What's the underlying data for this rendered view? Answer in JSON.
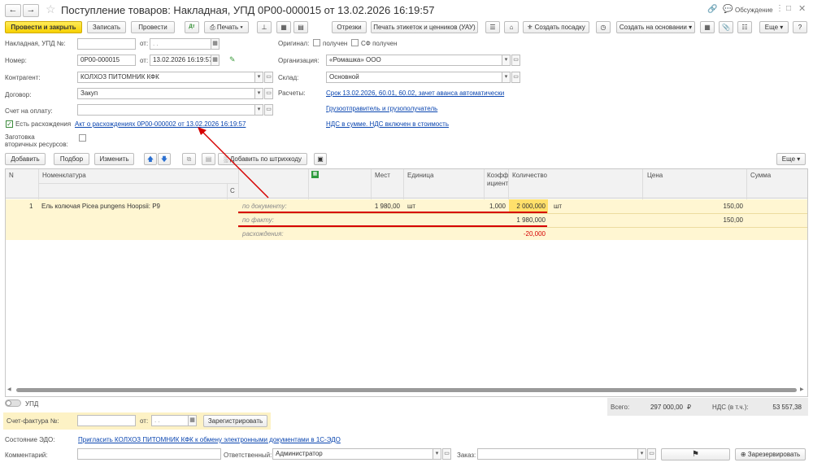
{
  "window": {
    "title": "Поступление товаров: Накладная, УПД 0Р00-000015 от 13.02.2026 16:19:57",
    "discussion": "Обсуждение"
  },
  "toolbar": {
    "post_close": "Провести и закрыть",
    "save": "Записать",
    "post": "Провести",
    "print": "Печать",
    "cuts": "Отрезки",
    "print_labels": "Печать этикеток и ценников (УАУ)",
    "create_planting": "Создать посадку",
    "create_based": "Создать на основании",
    "more": "Еще",
    "help": "?",
    "dtkt": "Дт Кт"
  },
  "form": {
    "invoice_label": "Накладная, УПД №:",
    "from_label": "от:",
    "invoice_no": "",
    "invoice_date": ". .",
    "number_label": "Номер:",
    "number": "0Р00-000015",
    "number_date": "13.02.2026 16:19:57",
    "counterparty_label": "Контрагент:",
    "counterparty": "КОЛХОЗ ПИТОМНИК КФК",
    "contract_label": "Договор:",
    "contract": "Закуп",
    "payment_invoice_label": "Счет на оплату:",
    "payment_invoice": "",
    "discrepancy_label": "Есть расхождения",
    "discrepancy_link": "Акт о расхождениях 0Р00-000002 от 13.02.2026 16:19:57",
    "secondary_label": "Заготовка вторичных ресурсов:",
    "original_label": "Оригинал:",
    "received": "получен",
    "sf_received": "СФ получен",
    "org_label": "Организация:",
    "org": "«Ромашка» ООО",
    "warehouse_label": "Склад:",
    "warehouse": "Основной",
    "settlements_label": "Расчеты:",
    "settlements_link": "Срок 13.02.2026, 60.01, 60.02, зачет аванса автоматически",
    "shipper_link": "Грузоотправитель и грузополучатель",
    "vat_link": "НДС в сумме. НДС включен в стоимость"
  },
  "table_toolbar": {
    "add": "Добавить",
    "select": "Подбор",
    "change": "Изменить",
    "barcode": "Добавить по штрихкоду",
    "more": "Еще"
  },
  "table": {
    "headers": {
      "n": "N",
      "nomenclature": "Номенклатура",
      "c": "С",
      "places": "Мест",
      "unit": "Единица",
      "coef1": "Коэфф",
      "coef2": "ициент",
      "qty": "Количество",
      "price": "Цена",
      "sum": "Сумма"
    },
    "row": {
      "n": "1",
      "name": "Ель колючая Picea pungens Hoopsii: Р9",
      "places": "1 980,00",
      "unit": "шт",
      "coef": "1,000",
      "qty_doc": "2 000,000",
      "qty_unit": "шт",
      "qty_fact": "1 980,000",
      "qty_diff": "-20,000",
      "price_doc": "150,00",
      "price_fact": "150,00",
      "by_doc": "по документу:",
      "by_fact": "по факту:",
      "diff": "расхождения:"
    }
  },
  "footer": {
    "upd": "УПД",
    "total_label": "Всего:",
    "total": "297 000,00",
    "currency": "₽",
    "vat_label": "НДС (в т.ч.):",
    "vat": "53 557,38",
    "sf_label": "Счет-фактура №:",
    "sf_from": "от:",
    "sf_date": ". .",
    "register": "Зарегистрировать",
    "edo_label": "Состояние ЭДО:",
    "edo_link": "Пригласить КОЛХОЗ ПИТОМНИК КФК к обмену электронными документами в 1С-ЭДО",
    "comment_label": "Комментарий:",
    "responsible_label": "Ответственный:",
    "responsible": "Администратор",
    "order_label": "Заказ:",
    "reserve": "Зарезервировать"
  },
  "colors": {
    "accent": "#f6d000",
    "row_bg": "#fff6d2",
    "red": "#d60000",
    "link": "#0b46b0"
  }
}
